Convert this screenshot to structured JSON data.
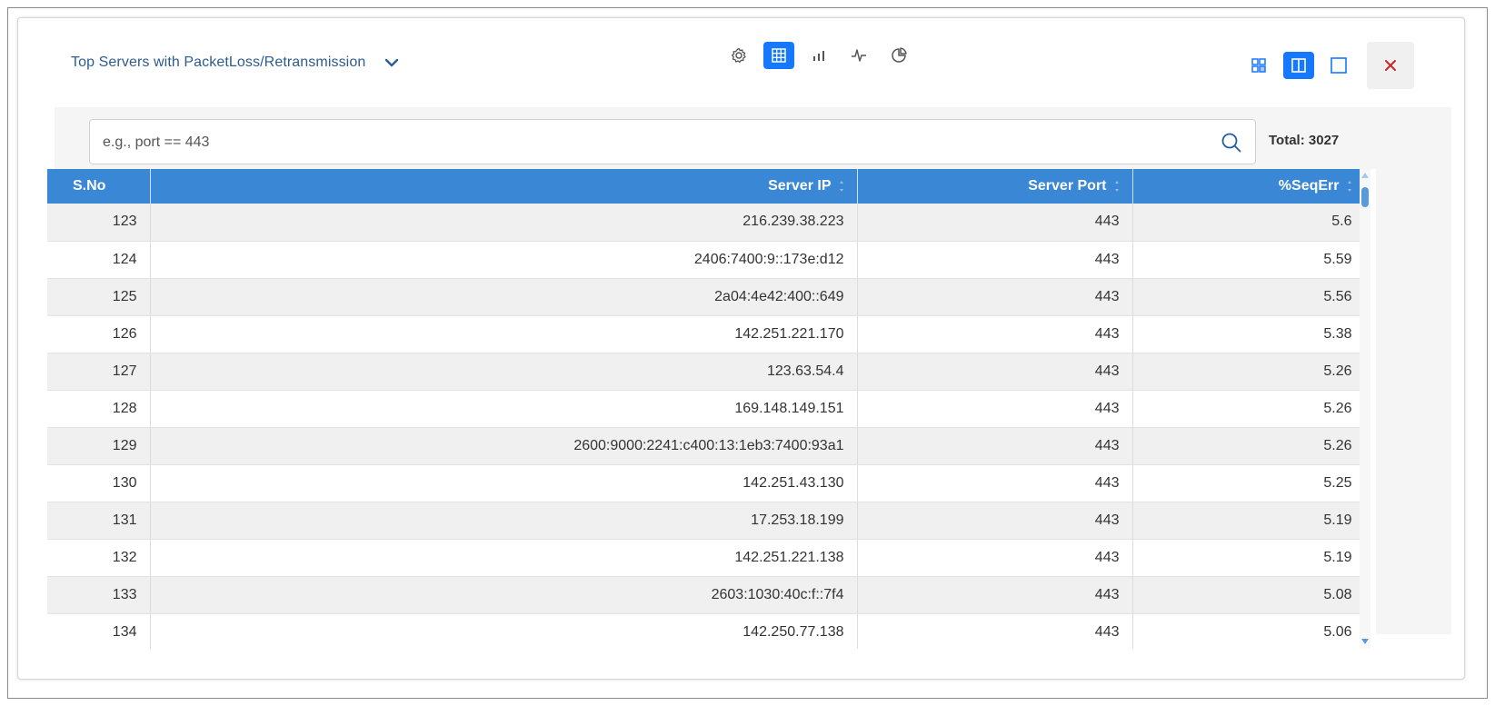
{
  "widget": {
    "title": "Top Servers with PacketLoss/Retransmission"
  },
  "toolbar": {
    "views": [
      "settings-icon",
      "table-icon",
      "bar-chart-icon",
      "line-chart-icon",
      "pie-chart-icon"
    ],
    "active_view": "table-icon",
    "layouts": [
      "grid-layout-icon",
      "split-layout-icon",
      "single-layout-icon"
    ],
    "active_layout": "split-layout-icon",
    "accent_color": "#1677ff",
    "close_color": "#c62828"
  },
  "search": {
    "placeholder": "e.g., port == 443",
    "value": ""
  },
  "total": {
    "label": "Total: 3027"
  },
  "table": {
    "header_color": "#3a87d6",
    "columns": [
      "S.No",
      "Server IP",
      "Server Port",
      "%SeqErr"
    ],
    "rows": [
      [
        "123",
        "216.239.38.223",
        "443",
        "5.6"
      ],
      [
        "124",
        "2406:7400:9::173e:d12",
        "443",
        "5.59"
      ],
      [
        "125",
        "2a04:4e42:400::649",
        "443",
        "5.56"
      ],
      [
        "126",
        "142.251.221.170",
        "443",
        "5.38"
      ],
      [
        "127",
        "123.63.54.4",
        "443",
        "5.26"
      ],
      [
        "128",
        "169.148.149.151",
        "443",
        "5.26"
      ],
      [
        "129",
        "2600:9000:2241:c400:13:1eb3:7400:93a1",
        "443",
        "5.26"
      ],
      [
        "130",
        "142.251.43.130",
        "443",
        "5.25"
      ],
      [
        "131",
        "17.253.18.199",
        "443",
        "5.19"
      ],
      [
        "132",
        "142.251.221.138",
        "443",
        "5.19"
      ],
      [
        "133",
        "2603:1030:40c:f::7f4",
        "443",
        "5.08"
      ],
      [
        "134",
        "142.250.77.138",
        "443",
        "5.06"
      ]
    ]
  }
}
